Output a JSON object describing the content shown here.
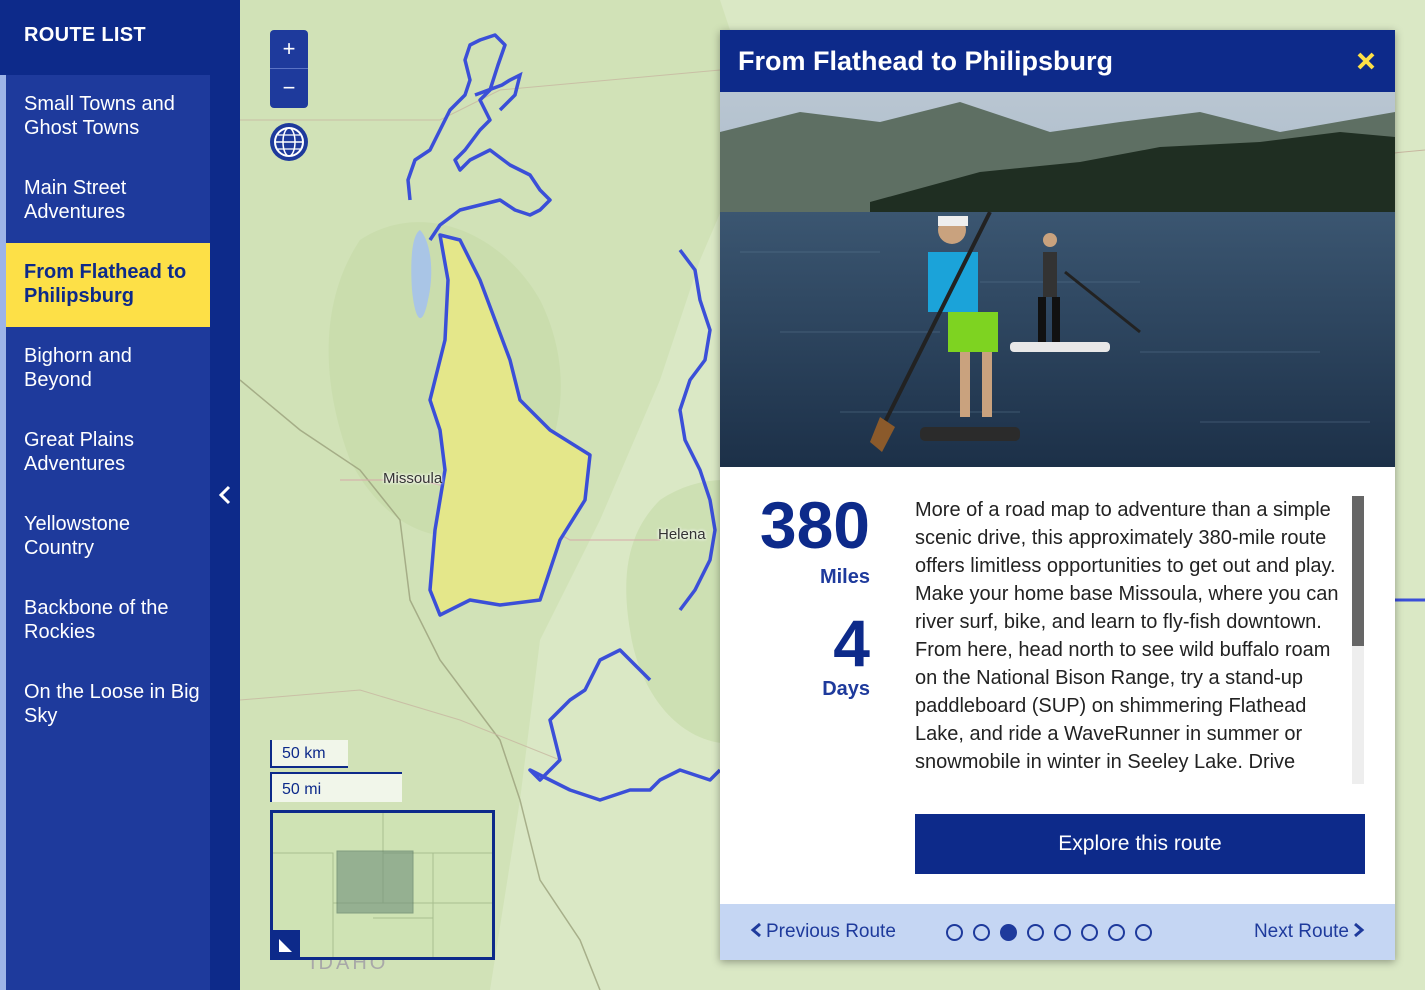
{
  "sidebar": {
    "header": "ROUTE LIST",
    "items": [
      {
        "label": "Small Towns and Ghost Towns",
        "active": false
      },
      {
        "label": "Main Street Adventures",
        "active": false
      },
      {
        "label": "From Flathead to Philipsburg",
        "active": true
      },
      {
        "label": "Bighorn and Beyond",
        "active": false
      },
      {
        "label": "Great Plains Adventures",
        "active": false
      },
      {
        "label": "Yellowstone Country",
        "active": false
      },
      {
        "label": "Backbone of the Rockies",
        "active": false
      },
      {
        "label": "On the Loose in Big Sky",
        "active": false
      }
    ],
    "collapse_icon": "‹"
  },
  "map": {
    "zoom_in": "+",
    "zoom_out": "−",
    "labels": {
      "missoula": "Missoula",
      "helena": "Helena",
      "idaho": "IDAHO"
    },
    "scale": {
      "km": "50 km",
      "mi": "50 mi"
    },
    "colors": {
      "route": "#3b4fd8",
      "region_fill": "#e4e78a",
      "land": "#dae8c5"
    }
  },
  "popup": {
    "title": "From Flathead to Philipsburg",
    "close_icon": "✕",
    "stats": {
      "miles": "380",
      "miles_label": "Miles",
      "days": "4",
      "days_label": "Days"
    },
    "description": "More of a road map to adventure than a simple scenic drive, this approximately 380-mile route offers limitless opportunities to get out and play. Make your home base Missoula, where you can river surf, bike, and learn to fly-fish downtown. From here, head north to see wild buffalo roam on the National Bison Range, try a stand-up paddleboard (SUP) on shimmering Flathead Lake, and ride a WaveRunner in summer or snowmobile in winter in Seeley Lake. Drive",
    "explore_label": "Explore this route",
    "prev_label": "Previous Route",
    "next_label": "Next Route",
    "pagination": {
      "total": 8,
      "current": 3
    }
  }
}
